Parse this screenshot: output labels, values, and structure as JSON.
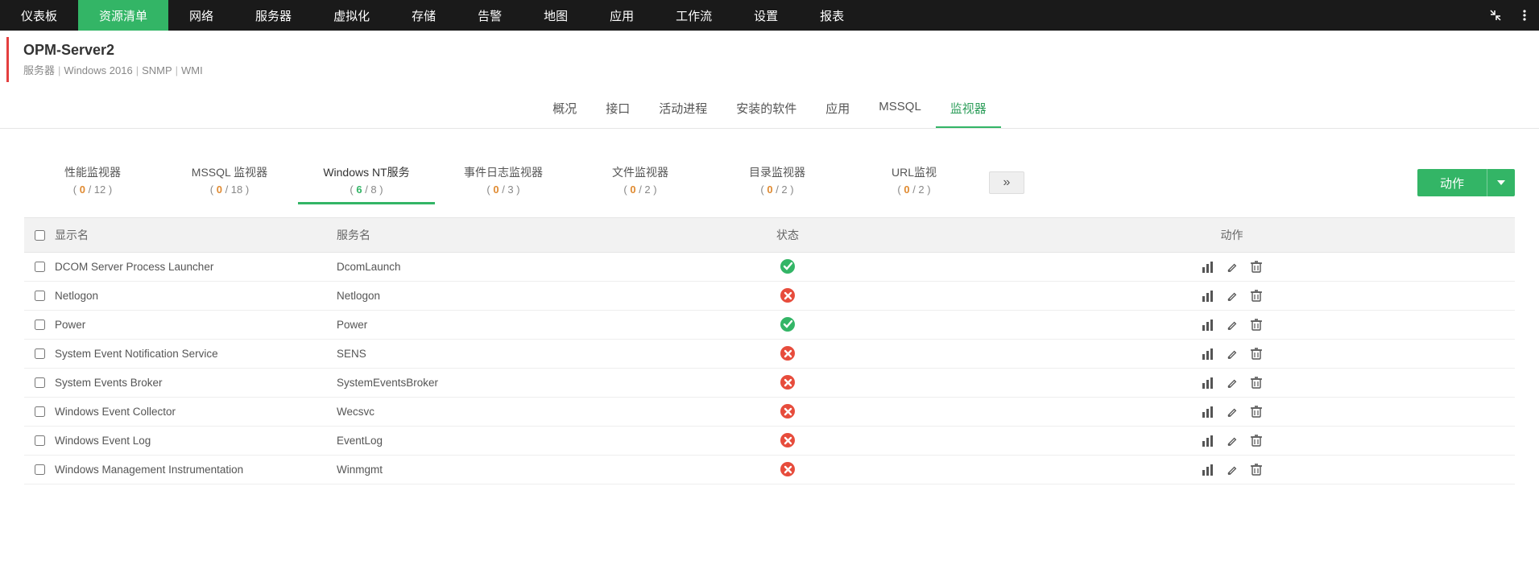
{
  "topnav": {
    "items": [
      {
        "label": "仪表板",
        "active": false
      },
      {
        "label": "资源清单",
        "active": true
      },
      {
        "label": "网络",
        "active": false
      },
      {
        "label": "服务器",
        "active": false
      },
      {
        "label": "虚拟化",
        "active": false
      },
      {
        "label": "存储",
        "active": false
      },
      {
        "label": "告警",
        "active": false
      },
      {
        "label": "地图",
        "active": false
      },
      {
        "label": "应用",
        "active": false
      },
      {
        "label": "工作流",
        "active": false
      },
      {
        "label": "设置",
        "active": false
      },
      {
        "label": "报表",
        "active": false
      }
    ]
  },
  "title": {
    "name": "OPM-Server2",
    "crumbs": [
      "服务器",
      "Windows 2016",
      "SNMP",
      "WMI"
    ]
  },
  "mid_tabs": [
    {
      "label": "概况",
      "active": false
    },
    {
      "label": "接口",
      "active": false
    },
    {
      "label": "活动进程",
      "active": false
    },
    {
      "label": "安装的软件",
      "active": false
    },
    {
      "label": "应用",
      "active": false
    },
    {
      "label": "MSSQL",
      "active": false
    },
    {
      "label": "监视器",
      "active": true
    }
  ],
  "monitor_cards": [
    {
      "title": "性能监视器",
      "alert": "0",
      "total": "12",
      "active": false
    },
    {
      "title": "MSSQL 监视器",
      "alert": "0",
      "total": "18",
      "active": false
    },
    {
      "title": "Windows NT服务",
      "alert": "6",
      "total": "8",
      "active": true
    },
    {
      "title": "事件日志监视器",
      "alert": "0",
      "total": "3",
      "active": false
    },
    {
      "title": "文件监视器",
      "alert": "0",
      "total": "2",
      "active": false
    },
    {
      "title": "目录监视器",
      "alert": "0",
      "total": "2",
      "active": false
    },
    {
      "title": "URL监视",
      "alert": "0",
      "total": "2",
      "active": false
    }
  ],
  "action_button_label": "动作",
  "table": {
    "headers": {
      "display": "显示名",
      "service": "服务名",
      "status": "状态",
      "actions": "动作"
    },
    "rows": [
      {
        "display": "DCOM Server Process Launcher",
        "service": "DcomLaunch",
        "status": "ok"
      },
      {
        "display": "Netlogon",
        "service": "Netlogon",
        "status": "bad"
      },
      {
        "display": "Power",
        "service": "Power",
        "status": "ok"
      },
      {
        "display": "System Event Notification Service",
        "service": "SENS",
        "status": "bad"
      },
      {
        "display": "System Events Broker",
        "service": "SystemEventsBroker",
        "status": "bad"
      },
      {
        "display": "Windows Event Collector",
        "service": "Wecsvc",
        "status": "bad"
      },
      {
        "display": "Windows Event Log",
        "service": "EventLog",
        "status": "bad"
      },
      {
        "display": "Windows Management Instrumentation",
        "service": "Winmgmt",
        "status": "bad"
      }
    ]
  }
}
